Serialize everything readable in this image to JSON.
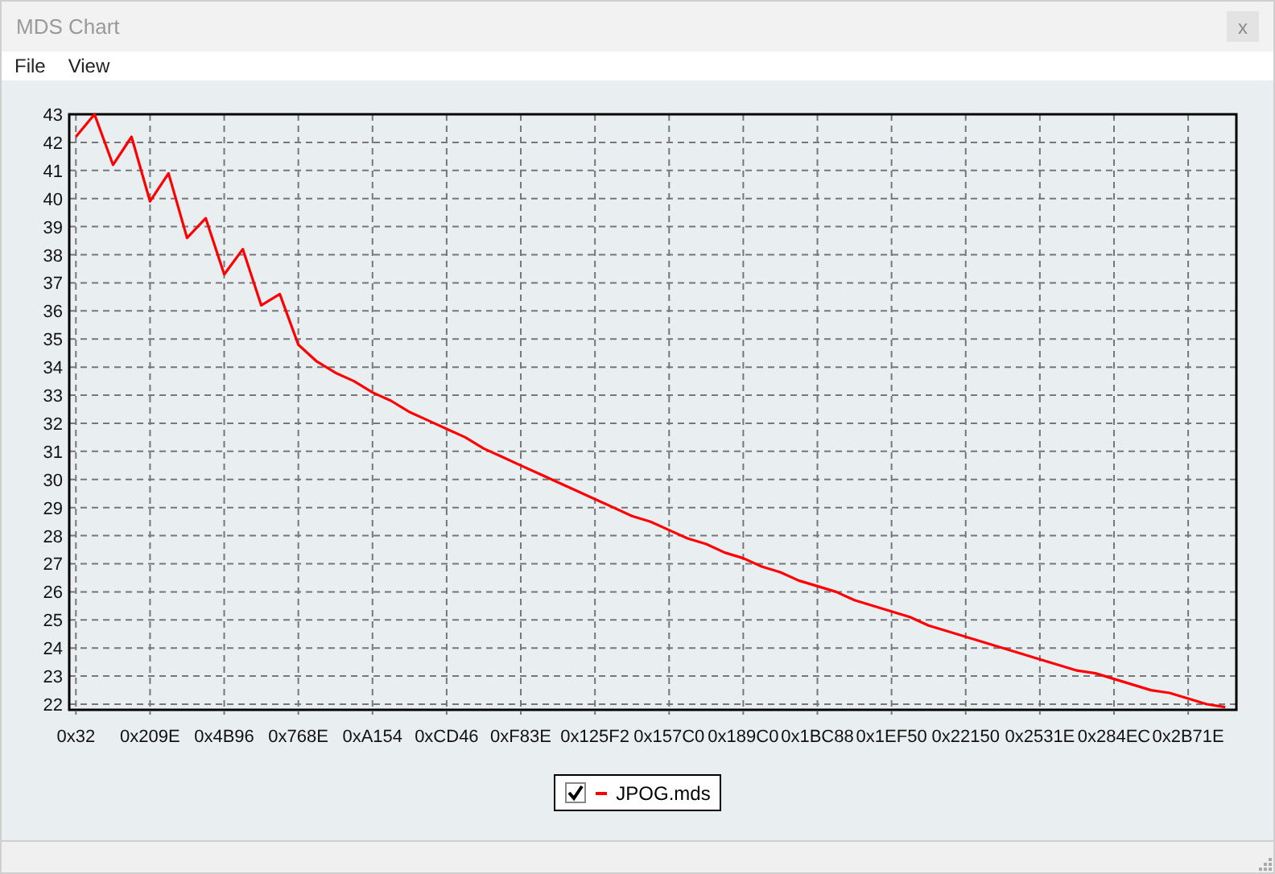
{
  "window": {
    "title": "MDS Chart",
    "close": "x"
  },
  "menu": [
    {
      "label": "File"
    },
    {
      "label": "View"
    }
  ],
  "chart_data": {
    "type": "line",
    "grid": true,
    "ylim": [
      21.8,
      43
    ],
    "yticks": [
      22,
      23,
      24,
      25,
      26,
      27,
      28,
      29,
      30,
      31,
      32,
      33,
      34,
      35,
      36,
      37,
      38,
      39,
      40,
      41,
      42,
      43
    ],
    "categories": [
      "0x32",
      null,
      null,
      null,
      "0x209E",
      null,
      null,
      null,
      "0x4B96",
      null,
      null,
      null,
      "0x768E",
      null,
      null,
      null,
      "0xA154",
      null,
      null,
      null,
      "0xCD46",
      null,
      null,
      null,
      "0xF83E",
      null,
      null,
      null,
      "0x125F2",
      null,
      null,
      null,
      "0x157C0",
      null,
      null,
      null,
      "0x189C0",
      null,
      null,
      null,
      "0x1BC88",
      null,
      null,
      null,
      "0x1EF50",
      null,
      null,
      null,
      "0x22150",
      null,
      null,
      null,
      "0x2531E",
      null,
      null,
      null,
      "0x284EC",
      null,
      null,
      null,
      "0x2B71E",
      null,
      null
    ],
    "series": [
      {
        "name": "JPOG.mds",
        "color": "#ff0000",
        "values": [
          42.2,
          43,
          41.2,
          42.2,
          39.9,
          40.9,
          38.6,
          39.3,
          37.3,
          38.2,
          36.2,
          36.6,
          34.8,
          34.2,
          33.8,
          33.5,
          33.1,
          32.8,
          32.4,
          32.1,
          31.8,
          31.5,
          31.1,
          30.8,
          30.5,
          30.2,
          29.9,
          29.6,
          29.3,
          29.0,
          28.7,
          28.5,
          28.2,
          27.9,
          27.7,
          27.4,
          27.2,
          26.9,
          26.7,
          26.4,
          26.2,
          26.0,
          25.7,
          25.5,
          25.3,
          25.1,
          24.8,
          24.6,
          24.4,
          24.2,
          24.0,
          23.8,
          23.6,
          23.4,
          23.2,
          23.1,
          22.9,
          22.7,
          22.5,
          22.4,
          22.2,
          22.0,
          21.9
        ]
      }
    ]
  },
  "legend": {
    "checked": true
  }
}
